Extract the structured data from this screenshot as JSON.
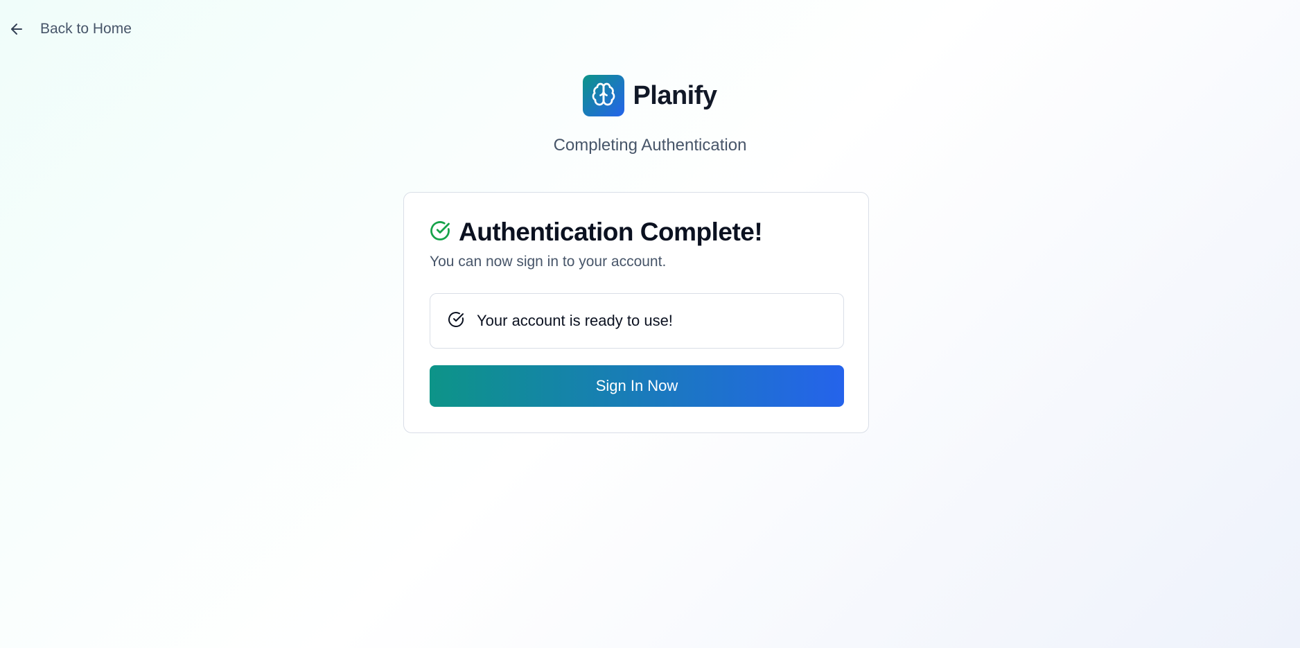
{
  "nav": {
    "back_label": "Back to Home",
    "back_icon": "arrow-left-icon"
  },
  "brand": {
    "name": "Planify",
    "logo_icon": "brain-icon",
    "logo_gradient": [
      "#0d9488",
      "#2563eb"
    ]
  },
  "header": {
    "subtitle": "Completing Authentication"
  },
  "card": {
    "title": "Authentication Complete!",
    "title_icon": "check-circle-icon",
    "title_icon_color": "#16a34a",
    "description": "You can now sign in to your account.",
    "status": {
      "icon": "check-circle-icon",
      "text": "Your account is ready to use!"
    },
    "button": {
      "label": "Sign In Now",
      "gradient": [
        "#0d9488",
        "#2563eb"
      ]
    }
  }
}
